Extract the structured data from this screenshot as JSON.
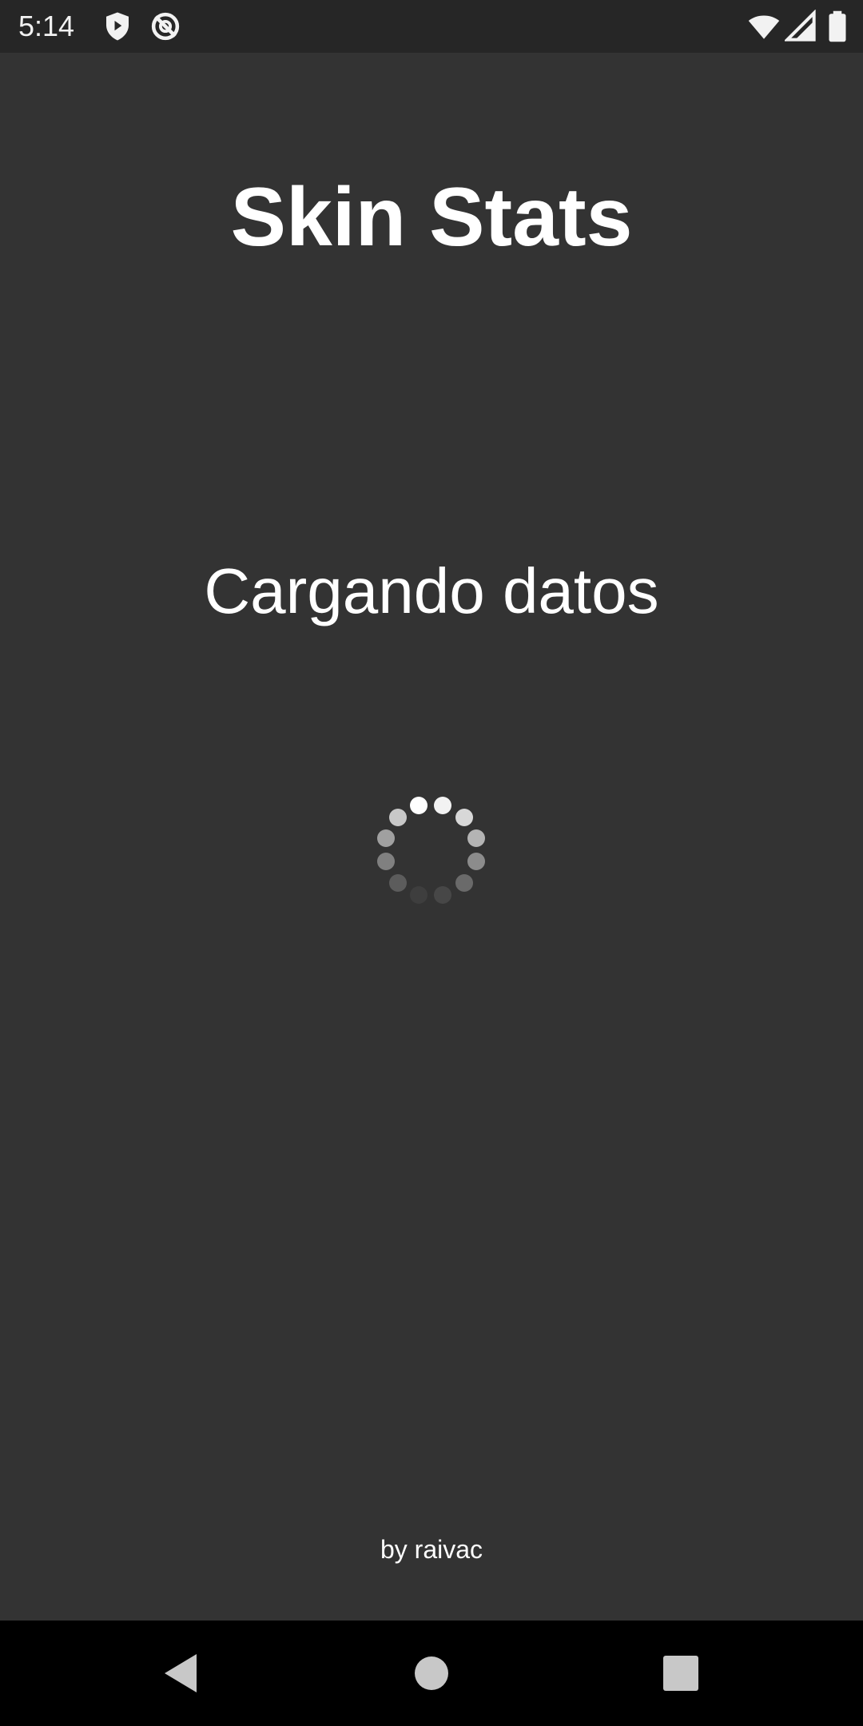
{
  "status_bar": {
    "time": "5:14",
    "icons": [
      "shield-play-icon",
      "no-sync-icon",
      "wifi-icon",
      "signal-icon",
      "battery-icon"
    ]
  },
  "app": {
    "title": "Skin Stats",
    "loading_text": "Cargando datos",
    "credit": "by raivac"
  },
  "nav_bar": {
    "buttons": [
      "back",
      "home",
      "recents"
    ]
  },
  "colors": {
    "background": "#333333",
    "status_bar": "#262626",
    "nav_bar": "#000000",
    "text": "#ffffff"
  }
}
